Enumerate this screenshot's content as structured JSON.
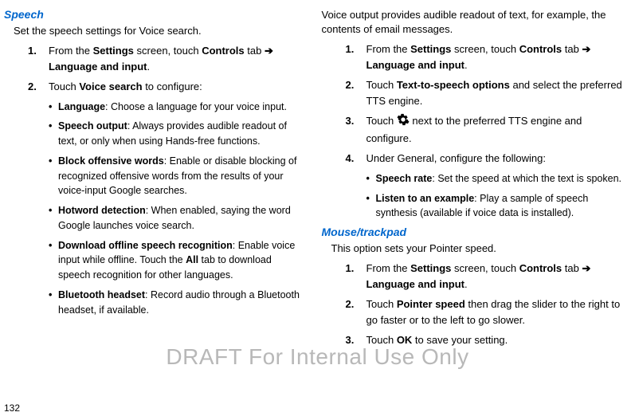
{
  "watermark": "DRAFT For Internal Use Only",
  "page_number": "132",
  "left": {
    "heading": "Speech",
    "intro": "Set the speech settings for Voice search.",
    "steps": [
      {
        "num": "1.",
        "prefix": "From the ",
        "bold1": "Settings",
        "mid1": " screen, touch ",
        "bold2": "Controls",
        "mid2": " tab ",
        "arrow": "➔",
        "mid3": " ",
        "bold3": "Language and input",
        "suffix": "."
      },
      {
        "num": "2.",
        "prefix": "Touch ",
        "bold1": "Voice search",
        "suffix": " to configure:"
      }
    ],
    "bullets": [
      {
        "bold": "Language",
        "text": ": Choose a language for your voice input."
      },
      {
        "bold": "Speech output",
        "text": ": Always provides audible readout of text, or only when using Hands-free functions."
      },
      {
        "bold": "Block offensive words",
        "text": ": Enable or disable blocking of recognized offensive words from the results of your voice-input Google searches."
      },
      {
        "bold": "Hotword detection",
        "text": ": When enabled, saying the word Google launches voice search."
      },
      {
        "bold": "Download offline speech recognition",
        "text_pre": ": Enable voice input while offline. Touch the ",
        "bold_mid": "All",
        "text_post": " tab to download speech recognition for other languages."
      },
      {
        "bold": "Bluetooth headset",
        "text": ": Record audio through a Bluetooth headset, if available."
      }
    ]
  },
  "right": {
    "intro_top": "Voice output provides audible readout of text, for example, the contents of email messages.",
    "steps_top": [
      {
        "num": "1.",
        "prefix": "From the ",
        "bold1": "Settings",
        "mid1": " screen, touch ",
        "bold2": "Controls",
        "mid2": " tab ",
        "arrow": "➔",
        "mid3": " ",
        "bold3": "Language and input",
        "suffix": "."
      },
      {
        "num": "2.",
        "prefix": "Touch ",
        "bold1": "Text-to-speech options",
        "suffix": " and select the preferred TTS engine."
      },
      {
        "num": "3.",
        "prefix": "Touch ",
        "icon": true,
        "suffix": " next to the preferred TTS engine and configure."
      },
      {
        "num": "4.",
        "prefix": "Under General, configure the following:"
      }
    ],
    "bullets_top": [
      {
        "bold": "Speech rate",
        "text": ": Set the speed at which the text is spoken."
      },
      {
        "bold": "Listen to an example",
        "text": ": Play a sample of speech synthesis (available if voice data is installed)."
      }
    ],
    "heading2": "Mouse/trackpad",
    "intro2": "This option sets your Pointer speed.",
    "steps2": [
      {
        "num": "1.",
        "prefix": "From the ",
        "bold1": "Settings",
        "mid1": " screen, touch ",
        "bold2": "Controls",
        "mid2": " tab ",
        "arrow": "➔",
        "mid3": " ",
        "bold3": "Language and input",
        "suffix": "."
      },
      {
        "num": "2.",
        "prefix": "Touch ",
        "bold1": "Pointer speed",
        "suffix": " then drag the slider to the right to go faster or to the left to go slower."
      },
      {
        "num": "3.",
        "prefix": "Touch ",
        "bold1": "OK",
        "suffix": " to save your setting."
      }
    ]
  }
}
